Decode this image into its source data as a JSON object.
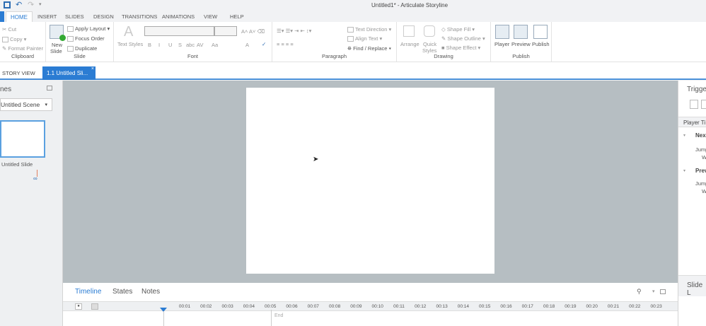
{
  "title": "Untitled1* -  Articulate Storyline",
  "ribbon_tabs": [
    "HOME",
    "INSERT",
    "SLIDES",
    "DESIGN",
    "TRANSITIONS",
    "ANIMATIONS",
    "VIEW",
    "HELP"
  ],
  "clipboard": {
    "label": "Clipboard",
    "cut": "Cut",
    "copy": "Copy",
    "format_painter": "Format Painter"
  },
  "slide_group": {
    "label": "Slide",
    "new_slide": "New",
    "new_slide2": "Slide",
    "apply_layout": "Apply Layout",
    "focus_order": "Focus Order",
    "duplicate": "Duplicate"
  },
  "font": {
    "label": "Font",
    "text_styles": "Text Styles",
    "bold": "B",
    "italic": "I",
    "underline": "U",
    "strike": "S",
    "abc": "abc",
    "av": "AV",
    "aa": "Aa",
    "a": "A"
  },
  "paragraph": {
    "label": "Paragraph",
    "text_direction": "Text Direction",
    "align_text": "Align Text",
    "find_replace": "Find / Replace"
  },
  "drawing": {
    "label": "Drawing",
    "arrange": "Arrange",
    "quick": "Quick",
    "styles": "Styles",
    "shape_fill": "Shape Fill",
    "shape_outline": "Shape Outline",
    "shape_effect": "Shape Effect"
  },
  "publish": {
    "label": "Publish",
    "player": "Player",
    "preview": "Preview",
    "publish": "Publish"
  },
  "doc_tabs": {
    "story_view": "STORY VIEW",
    "slide_tab": "1.1 Untitled Sli..."
  },
  "scenes": {
    "title": "nes",
    "scene_select": "Untitled Scene",
    "slide_name": "Untitled Slide"
  },
  "triggers": {
    "title": "Trigge",
    "player_triggers": "Player Ti",
    "next": "Nex",
    "jump1": "Jump",
    "w1": "W",
    "prev": "Prev",
    "jump2": "Jump",
    "w2": "W",
    "slide_layers": "Slide L"
  },
  "timeline": {
    "tabs": [
      "Timeline",
      "States",
      "Notes"
    ],
    "ticks": [
      "00:01",
      "00:02",
      "00:03",
      "00:04",
      "00:05",
      "00:06",
      "00:07",
      "00:08",
      "00:09",
      "00:10",
      "00:11",
      "00:12",
      "00:13",
      "00:14",
      "00:15",
      "00:16",
      "00:17",
      "00:18",
      "00:19",
      "00:20",
      "00:21",
      "00:22",
      "00:23"
    ],
    "end": "End"
  },
  "colors": {
    "accent": "#2b7cd3"
  }
}
